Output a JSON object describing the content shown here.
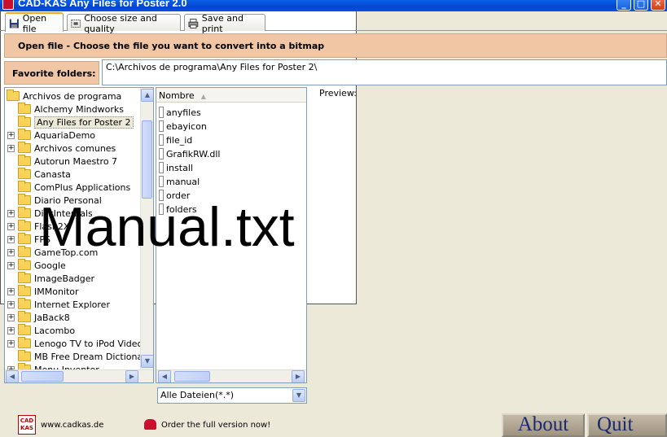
{
  "window": {
    "title": "CAD-KAS Any Files for Poster 2.0",
    "min": "_",
    "max": "□",
    "close": "✕"
  },
  "tabs": [
    {
      "label": "Open file",
      "active": true,
      "icon": "floppy-icon"
    },
    {
      "label": "Choose size and quality",
      "active": false,
      "icon": "size-icon"
    },
    {
      "label": "Save and print",
      "active": false,
      "icon": "printer-icon"
    }
  ],
  "header": {
    "text": "Open file - Choose the file you want to convert into a bitmap"
  },
  "favorites": {
    "label": "Favorite folders:",
    "value": "C:\\Archivos de programa\\Any Files for Poster 2\\"
  },
  "tree": {
    "root": "Archivos de programa",
    "items": [
      {
        "label": "Alchemy Mindworks",
        "expandable": false,
        "selected": false
      },
      {
        "label": "Any Files for Poster 2",
        "expandable": false,
        "selected": true
      },
      {
        "label": "AquariaDemo",
        "expandable": true,
        "selected": false
      },
      {
        "label": "Archivos comunes",
        "expandable": true,
        "selected": false
      },
      {
        "label": "Autorun Maestro 7",
        "expandable": false,
        "selected": false
      },
      {
        "label": "Canasta",
        "expandable": false,
        "selected": false
      },
      {
        "label": "ComPlus Applications",
        "expandable": false,
        "selected": false
      },
      {
        "label": "Diario Personal",
        "expandable": false,
        "selected": false
      },
      {
        "label": "DiskInternals",
        "expandable": true,
        "selected": false
      },
      {
        "label": "Flash2X",
        "expandable": true,
        "selected": false
      },
      {
        "label": "FPS",
        "expandable": true,
        "selected": false
      },
      {
        "label": "GameTop.com",
        "expandable": true,
        "selected": false
      },
      {
        "label": "Google",
        "expandable": true,
        "selected": false
      },
      {
        "label": "ImageBadger",
        "expandable": false,
        "selected": false
      },
      {
        "label": "IMMonitor",
        "expandable": true,
        "selected": false
      },
      {
        "label": "Internet Explorer",
        "expandable": true,
        "selected": false
      },
      {
        "label": "JaBack8",
        "expandable": true,
        "selected": false
      },
      {
        "label": "Lacombo",
        "expandable": true,
        "selected": false
      },
      {
        "label": "Lenogo TV to iPod Video Tr",
        "expandable": true,
        "selected": false
      },
      {
        "label": "MB Free Dream Dictionary",
        "expandable": false,
        "selected": false
      },
      {
        "label": "Menu Inventor",
        "expandable": true,
        "selected": false
      }
    ]
  },
  "files": {
    "column": "Nombre",
    "items": [
      "anyfiles",
      "ebayicon",
      "file_id",
      "GrafikRW.dll",
      "install",
      "manual",
      "order",
      "folders"
    ]
  },
  "filter": {
    "value": "Alle Dateien(*.*)"
  },
  "preview": {
    "label": "Preview:",
    "text": "Manual.txt"
  },
  "footer": {
    "logo": "CAD KAS",
    "site": "www.cadkas.de",
    "order": "Order the full version now!",
    "about": "About",
    "quit": "Quit"
  }
}
